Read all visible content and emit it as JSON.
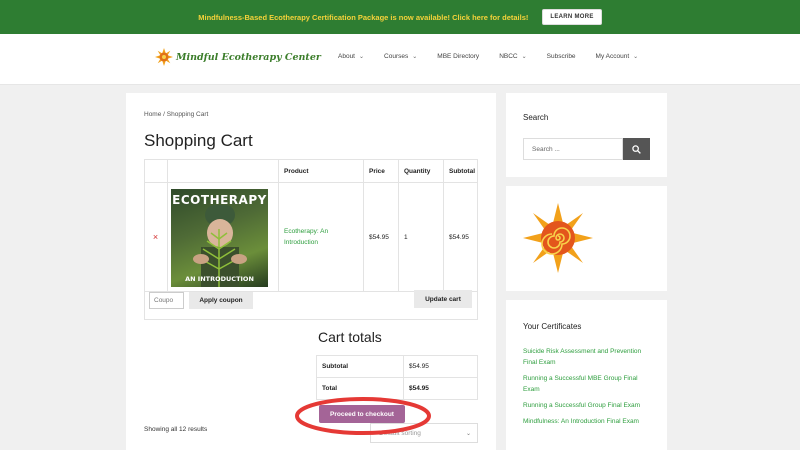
{
  "banner": {
    "text": "Mindfulness-Based Ecotherapy Certification Package  is now available! Click here for details!",
    "button": "LEARN MORE"
  },
  "header": {
    "logo_text": "Mindful Ecotherapy Center",
    "nav": [
      {
        "label": "About",
        "has_dropdown": true
      },
      {
        "label": "Courses",
        "has_dropdown": true
      },
      {
        "label": "MBE Directory",
        "has_dropdown": false
      },
      {
        "label": "NBCC",
        "has_dropdown": true
      },
      {
        "label": "Subscribe",
        "has_dropdown": false
      },
      {
        "label": "My Account",
        "has_dropdown": true
      }
    ]
  },
  "main": {
    "breadcrumb": "Home / Shopping Cart",
    "title": "Shopping Cart",
    "cart_table": {
      "headers": [
        "",
        "",
        "Product",
        "Price",
        "Quantity",
        "Subtotal"
      ],
      "items": [
        {
          "remove": "×",
          "image_title": "ECOTHERAPY",
          "image_subtitle": "AN INTRODUCTION",
          "product": "Ecotherapy: An Introduction",
          "price": "$54.95",
          "quantity": "1",
          "subtotal": "$54.95"
        }
      ]
    },
    "coupon_placeholder": "Coupo",
    "apply_coupon": "Apply coupon",
    "update_cart": "Update cart",
    "cart_totals": {
      "title": "Cart totals",
      "rows": [
        {
          "label": "Subtotal",
          "value": "$54.95"
        },
        {
          "label": "Total",
          "value": "$54.95"
        }
      ]
    },
    "checkout_button": "Proceed to checkout",
    "showing_results": "Showing all 12 results",
    "sort_select": "Default sorting"
  },
  "sidebar": {
    "search_title": "Search",
    "search_placeholder": "Search ...",
    "certificates_title": "Your Certificates",
    "certificates": [
      "Suicide Risk Assessment and Prevention Final Exam",
      "Running a Successful MBE Group Final Exam",
      "Running a Successful Group Final Exam",
      "Mindfulness: An Introduction Final Exam"
    ]
  },
  "colors": {
    "banner_bg": "#2e7d32",
    "banner_text": "#f5d23a",
    "link_green": "#2e9e3e",
    "checkout_purple": "#a46497",
    "annotation_red": "#e53935"
  }
}
